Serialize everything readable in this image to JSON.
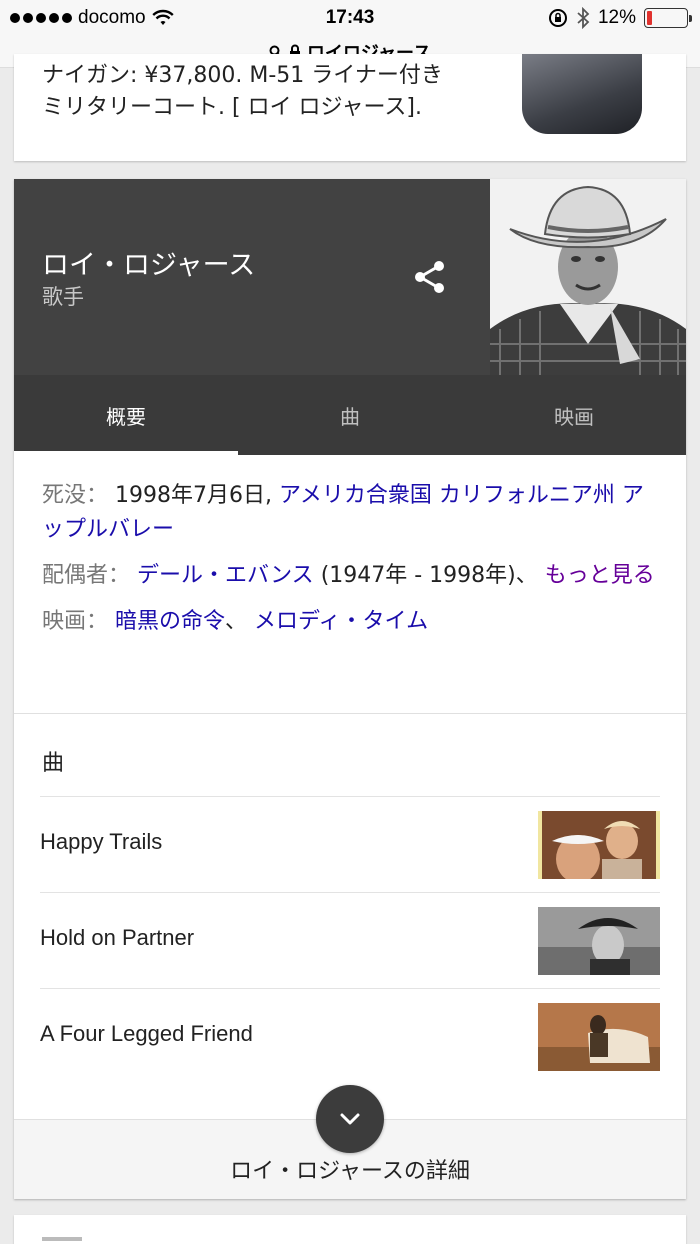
{
  "status_bar": {
    "carrier": "docomo",
    "time": "17:43",
    "battery": "12%",
    "battery_level": 0.12
  },
  "url_bar": {
    "title": "ロイロジャース"
  },
  "top_result": {
    "snippet": "ナイガン: ¥37,800. M-51 ライナー付きミリタリーコート. [ ロイ ロジャース]."
  },
  "knowledge_panel": {
    "title": "ロイ・ロジャース",
    "subtitle": "歌手",
    "tabs": [
      {
        "label": "概要",
        "active": true
      },
      {
        "label": "曲",
        "active": false
      },
      {
        "label": "映画",
        "active": false
      }
    ],
    "facts": {
      "death_label": "死没：",
      "death_date": "1998年7月6日,",
      "death_place": "アメリカ合衆国 カリフォルニア州 アップルバレー",
      "spouse_label": "配偶者：",
      "spouse_name": "デール・エバンス",
      "spouse_years": "(1947年 - 1998年)、",
      "spouse_more": "もっと見る",
      "films_label": "映画：",
      "film_1": "暗黒の命令",
      "film_sep": "、",
      "film_2": "メロディ・タイム"
    },
    "songs_heading": "曲",
    "songs": [
      {
        "title": "Happy Trails"
      },
      {
        "title": "Hold on Partner"
      },
      {
        "title": "A Four Legged Friend"
      }
    ],
    "more_label": "ロイ・ロジャースの詳細"
  },
  "colors": {
    "header_bg": "#424242",
    "tabs_bg": "#3a3a3a",
    "link": "#1a0dab",
    "visited_link": "#660099"
  },
  "icons": [
    "wifi-icon",
    "lock-icon",
    "search-icon",
    "rotation-lock-icon",
    "bluetooth-icon",
    "battery-icon",
    "share-icon",
    "chevron-down-icon"
  ]
}
